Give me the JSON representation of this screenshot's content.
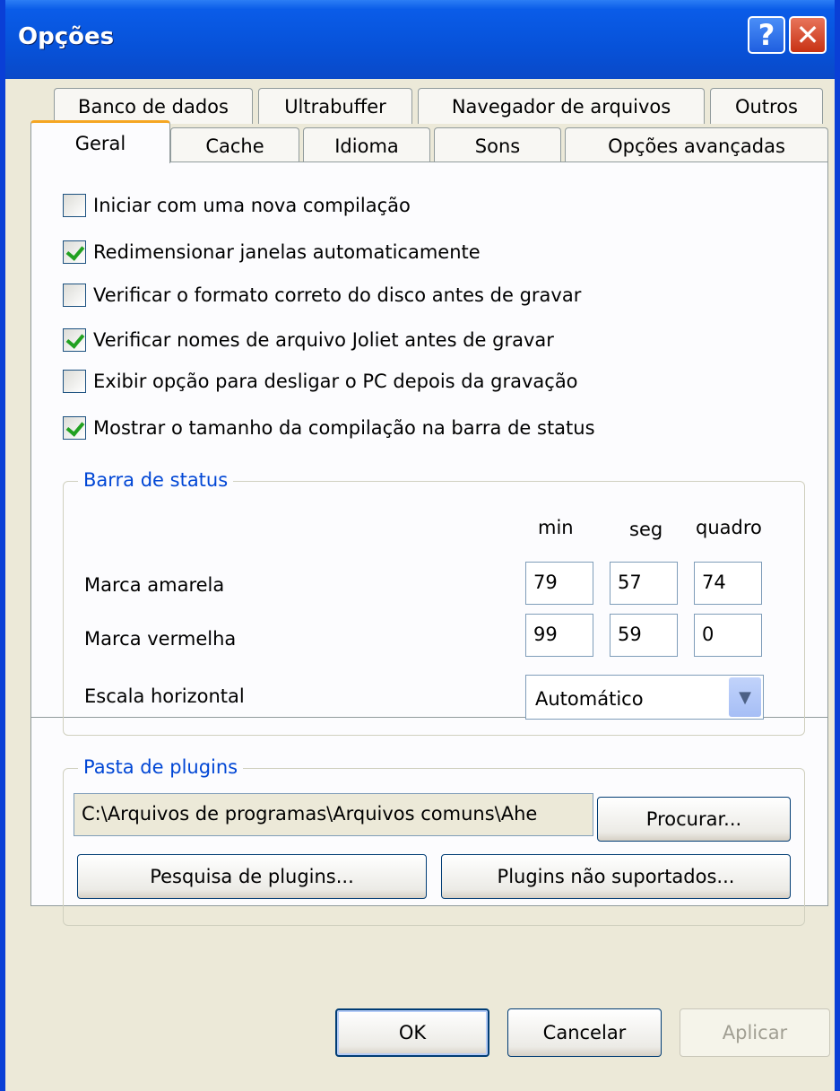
{
  "window": {
    "title": "Opções",
    "help_glyph": "?",
    "close_glyph": "✕"
  },
  "tabs_row1": [
    {
      "label": "Banco de dados"
    },
    {
      "label": "Ultrabuffer"
    },
    {
      "label": "Navegador de arquivos"
    },
    {
      "label": "Outros"
    }
  ],
  "tabs_row2": [
    {
      "label": "Geral",
      "active": true
    },
    {
      "label": "Cache"
    },
    {
      "label": "Idioma"
    },
    {
      "label": "Sons"
    },
    {
      "label": "Opções avançadas"
    }
  ],
  "options": [
    {
      "label": "Iniciar com uma nova compilação",
      "checked": false
    },
    {
      "label": "Redimensionar janelas automaticamente",
      "checked": true
    },
    {
      "label": "Verificar o formato correto do disco antes de gravar",
      "checked": false
    },
    {
      "label": "Verificar nomes de arquivo Joliet antes de gravar",
      "checked": true
    },
    {
      "label": "Exibir opção para desligar o PC depois da gravação",
      "checked": false
    },
    {
      "label": "Mostrar o tamanho da compilação na barra de status",
      "checked": true
    }
  ],
  "status_bar": {
    "group_label": "Barra de status",
    "col_min": "min",
    "col_seg": "seg",
    "col_quadro": "quadro",
    "yellow_label": "Marca amarela",
    "yellow": {
      "min": "79",
      "seg": "57",
      "quadro": "74"
    },
    "red_label": "Marca vermelha",
    "red": {
      "min": "99",
      "seg": "59",
      "quadro": "0"
    },
    "scale_label": "Escala horizontal",
    "scale_value": "Automático"
  },
  "plugins": {
    "group_label": "Pasta de plugins",
    "path": "C:\\Arquivos de programas\\Arquivos comuns\\Ahe",
    "browse_label": "Procurar...",
    "search_label": "Pesquisa de plugins...",
    "unsupported_label": "Plugins não suportados..."
  },
  "footer": {
    "ok_label": "OK",
    "cancel_label": "Cancelar",
    "apply_label": "Aplicar"
  }
}
